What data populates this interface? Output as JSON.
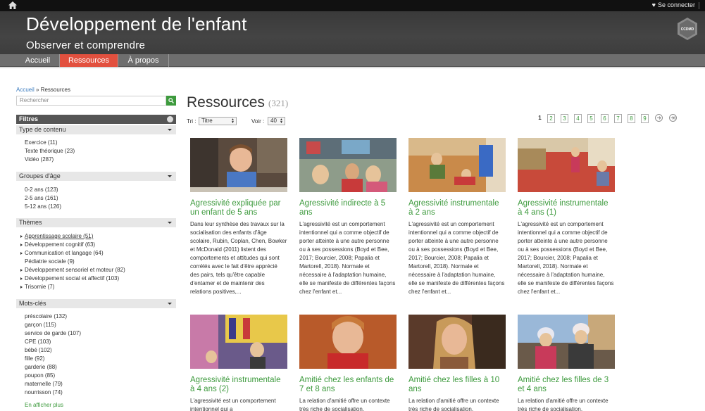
{
  "topbar": {
    "login_label": "Se connecter"
  },
  "header": {
    "title": "Développement de l'enfant",
    "subtitle": "Observer et comprendre",
    "logo_text": "CCDMD"
  },
  "nav": {
    "items": [
      {
        "label": "Accueil"
      },
      {
        "label": "Ressources",
        "active": true
      },
      {
        "label": "À propos"
      }
    ]
  },
  "breadcrumb": {
    "home": "Accueil",
    "separator": " » ",
    "current": "Ressources"
  },
  "search": {
    "placeholder": "Rechercher"
  },
  "filters": {
    "title": "Filtres",
    "sections": [
      {
        "title": "Type de contenu",
        "items": [
          "Exercice (11)",
          "Texte théorique (23)",
          "Vidéo (287)"
        ]
      },
      {
        "title": "Groupes d'âge",
        "items": [
          "0-2 ans (123)",
          "2-5 ans (161)",
          "5-12 ans (126)"
        ]
      },
      {
        "title": "Thèmes",
        "items": [
          "Apprentissage scolaire (51)",
          "Développement cognitif (63)",
          "Communication et langage (64)",
          "Pédiatrie sociale (9)",
          "Développement sensoriel et moteur (82)",
          "Développement social et affectif (103)",
          "Trisomie (7)"
        ]
      },
      {
        "title": "Mots-clés",
        "items": [
          "préscolaire (132)",
          "garçon (115)",
          "service de garde (107)",
          "CPE (103)",
          "bébé (102)",
          "fille (92)",
          "garderie (88)",
          "poupon (85)",
          "maternelle (79)",
          "nourrisson (74)"
        ]
      }
    ],
    "more_label": "En afficher plus"
  },
  "main": {
    "title": "Ressources",
    "count": "(321)",
    "sort_label": "Tri :",
    "sort_value": "Titre",
    "view_label": "Voir :",
    "view_value": "40",
    "pages": [
      "1",
      "2",
      "3",
      "4",
      "5",
      "6",
      "7",
      "8",
      "9"
    ]
  },
  "cards": [
    {
      "title": "Agressivité expliquée par un enfant de 5 ans",
      "desc": "Dans leur synthèse des travaux sur la socialisation des enfants d'âge scolaire, Rubin, Coplan, Chen, Bowker et McDonald (2011) listent des comportements et attitudes qui sont corrélés avec le fait d'être apprécié des pairs, tels qu'être capable d'entamer et de maintenir des relations positives,..."
    },
    {
      "title": "Agressivité indirecte à 5 ans",
      "desc": "L'agressivité est un comportement intentionnel qui a comme objectif de porter atteinte à une autre personne ou à ses possessions (Boyd et Bee, 2017; Bourcier, 2008; Papalia et Martorell, 2018). Normale et nécessaire à l'adaptation humaine, elle se manifeste de différentes façons chez l'enfant et..."
    },
    {
      "title": "Agressivité instrumentale à 2 ans",
      "desc": "L'agressivité est un comportement intentionnel qui a comme objectif de porter atteinte à une autre personne ou à ses possessions (Boyd et Bee, 2017; Bourcier, 2008; Papalia et Martorell, 2018). Normale et nécessaire à l'adaptation humaine, elle se manifeste de différentes façons chez l'enfant et..."
    },
    {
      "title": "Agressivité instrumentale à 4 ans (1)",
      "desc": "L'agressivité est un comportement intentionnel qui a comme objectif de porter atteinte à une autre personne ou à ses possessions (Boyd et Bee, 2017; Bourcier, 2008; Papalia et Martorell, 2018). Normale et nécessaire à l'adaptation humaine, elle se manifeste de différentes façons chez l'enfant et..."
    },
    {
      "title": "Agressivité instrumentale à 4 ans (2)",
      "desc": "L'agressivité est un comportement intentionnel qui a"
    },
    {
      "title": "Amitié chez les enfants de 7 et 8 ans",
      "desc": "La relation d'amitié offre un contexte très riche de socialisation."
    },
    {
      "title": "Amitié chez les filles à 10 ans",
      "desc": "La relation d'amitié offre un contexte très riche de socialisation."
    },
    {
      "title": "Amitié chez les filles de 3 et 4 ans",
      "desc": "La relation d'amitié offre un contexte très riche de socialisation."
    }
  ]
}
